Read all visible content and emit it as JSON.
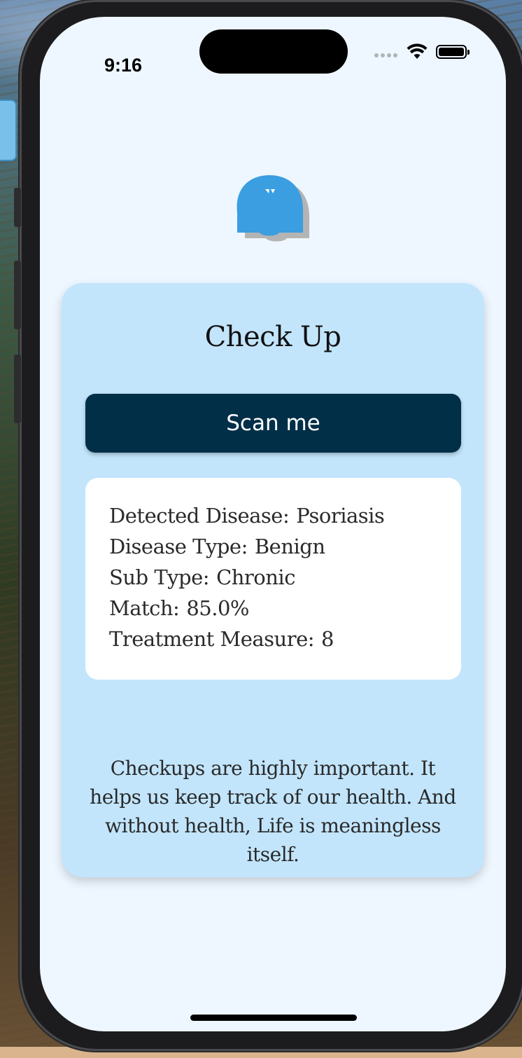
{
  "status_bar": {
    "time": "9:16",
    "icons": [
      "signal-dots-icon",
      "wifi-icon",
      "battery-icon"
    ]
  },
  "logo": {
    "icon": "app-logo-icon",
    "color": "#3a9ee0"
  },
  "card": {
    "title": "Check Up",
    "scan_button_label": "Scan me",
    "results": [
      {
        "label": "Detected Disease:",
        "value": "Psoriasis"
      },
      {
        "label": "Disease Type:",
        "value": "Benign"
      },
      {
        "label": "Sub Type:",
        "value": "Chronic"
      },
      {
        "label": "Match:",
        "value": "85.0%"
      },
      {
        "label": "Treatment Measure:",
        "value": "8"
      }
    ],
    "quote": "Checkups are highly important. It helps us keep track of our health. And without health, Life is meaningless itself."
  },
  "colors": {
    "screen_background": "#eef7ff",
    "card_background": "#c2e5fc",
    "button_background": "#012f48",
    "button_text": "#ffffff"
  }
}
